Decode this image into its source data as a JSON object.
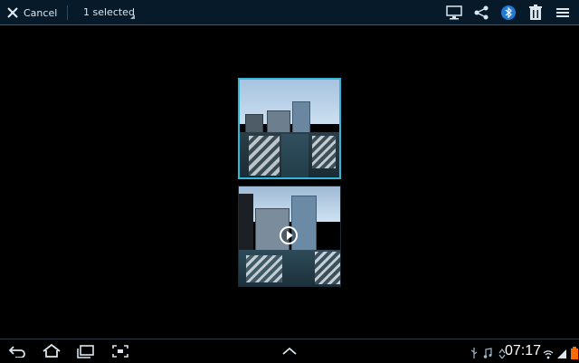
{
  "top_bar": {
    "cancel_label": "Cancel",
    "selection_label": "1 selected",
    "action_icons": [
      "screen-mirror-icon",
      "share-icon",
      "bluetooth-icon",
      "delete-icon",
      "menu-icon"
    ]
  },
  "thumbnails": [
    {
      "type": "photo",
      "selected": true
    },
    {
      "type": "video",
      "selected": false
    }
  ],
  "status_bar": {
    "time": "07:17",
    "nav_icons": [
      "back-icon",
      "home-icon",
      "recent-apps-icon",
      "screenshot-icon"
    ],
    "center_icon": "chevron-up-icon",
    "status_icons": [
      "usb-icon",
      "music-icon",
      "sync-icon",
      "wifi-icon",
      "signal-icon",
      "battery-icon"
    ]
  },
  "colors": {
    "topbar_bg": "#071a2a",
    "accent": "#35b7d9",
    "bluetooth_blue": "#1f7bd6"
  }
}
